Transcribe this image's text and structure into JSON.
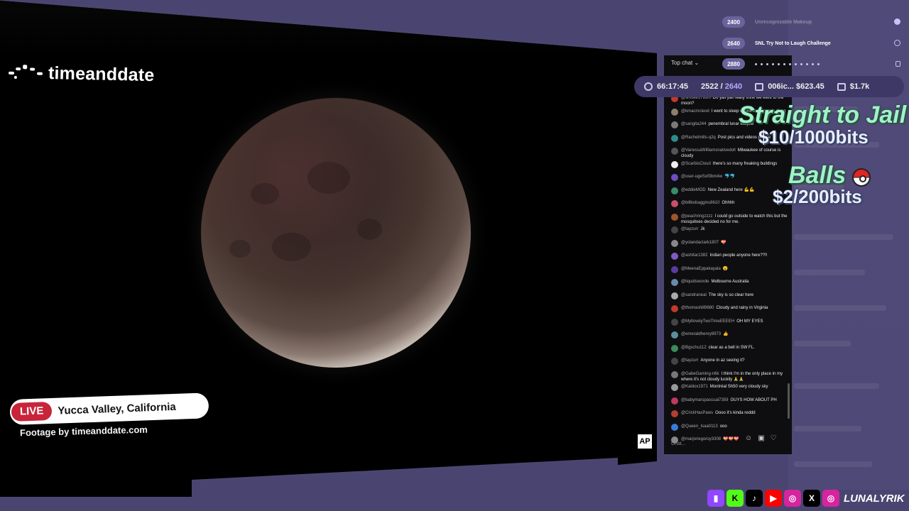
{
  "stream": {
    "brand": "timeanddate",
    "live_label": "LIVE",
    "location": "Yucca Valley, California",
    "footage_credit": "Footage by timeanddate.com",
    "ap_logo": "AP"
  },
  "chat": {
    "header": "Top chat",
    "input_placeholder": "Chat...",
    "messages": [
      {
        "user": "@smoke17sum",
        "text": "Do yall yall really think we went to the moon?",
        "color": "#c0392b"
      },
      {
        "user": "@kmacmcleod",
        "text": "I went to sleep where the moon is dang",
        "color": "#8e7f6a"
      },
      {
        "user": "@sangita244",
        "text": "penembral lunar eclipse",
        "color": "#7a7a7a"
      },
      {
        "user": "@Rachelmills-q2q",
        "text": "Post pics and videos please",
        "color": "#2e8b8b"
      },
      {
        "user": "@VanessaWilliamsnativedoll",
        "text": "Milwaukee of course is cloudy",
        "color": "#555"
      },
      {
        "user": "@ScarbisCloud",
        "text": "there's so many freaking buildings",
        "color": "#eee"
      },
      {
        "user": "@user-ugeSof3bm4w",
        "text": "🐬🐬",
        "color": "#6b4ec2"
      },
      {
        "user": "@eddieMOD",
        "text": "New Zealand here 💪💪",
        "color": "#3a8b6a"
      },
      {
        "user": "@billbobaggins8610",
        "text": "Ohhhh",
        "color": "#c84f6b"
      },
      {
        "user": "@peachringzzzz",
        "text": "I could go outside to watch this but the mosquitoes decided no for me.",
        "color": "#a0542a"
      },
      {
        "user": "@tayzurr",
        "text": "Jk",
        "color": "#444"
      },
      {
        "user": "@yolandaclark1807",
        "text": "💝",
        "color": "#888"
      },
      {
        "user": "@ashitar1382",
        "text": "Indian people anyone here??!!",
        "color": "#7e5bbf"
      },
      {
        "user": "@MeenaEppakayala",
        "text": "😮",
        "color": "#5a3aa0"
      },
      {
        "user": "@liquidsworde",
        "text": "Melbourne Australia",
        "color": "#6a8aa8"
      },
      {
        "user": "@sandraneal",
        "text": "The sky is so clear here",
        "color": "#aaa"
      },
      {
        "user": "@thomashill9680",
        "text": "Cloudy and rainy in Virginia",
        "color": "#c0392b"
      },
      {
        "user": "@MyllovelyTwoTimeEEEEH",
        "text": "OH MY EYES",
        "color": "#444"
      },
      {
        "user": "@emeraldhenry8973",
        "text": "👍",
        "color": "#5a8fa0"
      },
      {
        "user": "@Bgschu112",
        "text": "clear as a bell in SW FL.",
        "color": "#3a8b5a"
      },
      {
        "user": "@tayzurr",
        "text": "Anyone in az seeing it?",
        "color": "#444"
      },
      {
        "user": "@GabeGaming-n6k",
        "text": "I think I'm in the only place in my where it's not cloudy luckily 🙏🙏",
        "color": "#777"
      },
      {
        "user": "@Kaldox1971",
        "text": "Montréal Sh50 very cloudy sky",
        "color": "#999"
      },
      {
        "user": "@babymarspascual7359",
        "text": "GUYS HOW ABOUT PH",
        "color": "#c0395b"
      },
      {
        "user": "@CrickHasPaws",
        "text": "Oooo it's kinda reddd",
        "color": "#b04030"
      },
      {
        "user": "@Queen_Isaa0113",
        "text": "ooo",
        "color": "#3a7bd5"
      },
      {
        "user": "@marjoriegoroy3308",
        "text": "💝💝💝",
        "color": "#888"
      }
    ]
  },
  "stats": {
    "timer": "66:17:45",
    "subs_current": "2522",
    "subs_goal": "2640",
    "item1": "006ic...",
    "item1_amount": "$623.45",
    "item2_amount": "$1.7k"
  },
  "goals": [
    {
      "num": "2400",
      "label": "Unrecognizable Makeup"
    },
    {
      "num": "2640",
      "label": "SNL Try Not to Laugh Challenge"
    },
    {
      "num": "2880",
      "label": ""
    }
  ],
  "redeems": [
    {
      "name": "Straight to Jail",
      "cost": "$10/1000bits"
    },
    {
      "name": "Balls",
      "cost": "$2/200bits"
    }
  ],
  "socials": {
    "handle": "LUNALYRIK",
    "icons": [
      "twitch-icon",
      "kick-icon",
      "tiktok-icon",
      "youtube-icon",
      "instagram-icon",
      "x-icon",
      "instagram-icon"
    ]
  }
}
